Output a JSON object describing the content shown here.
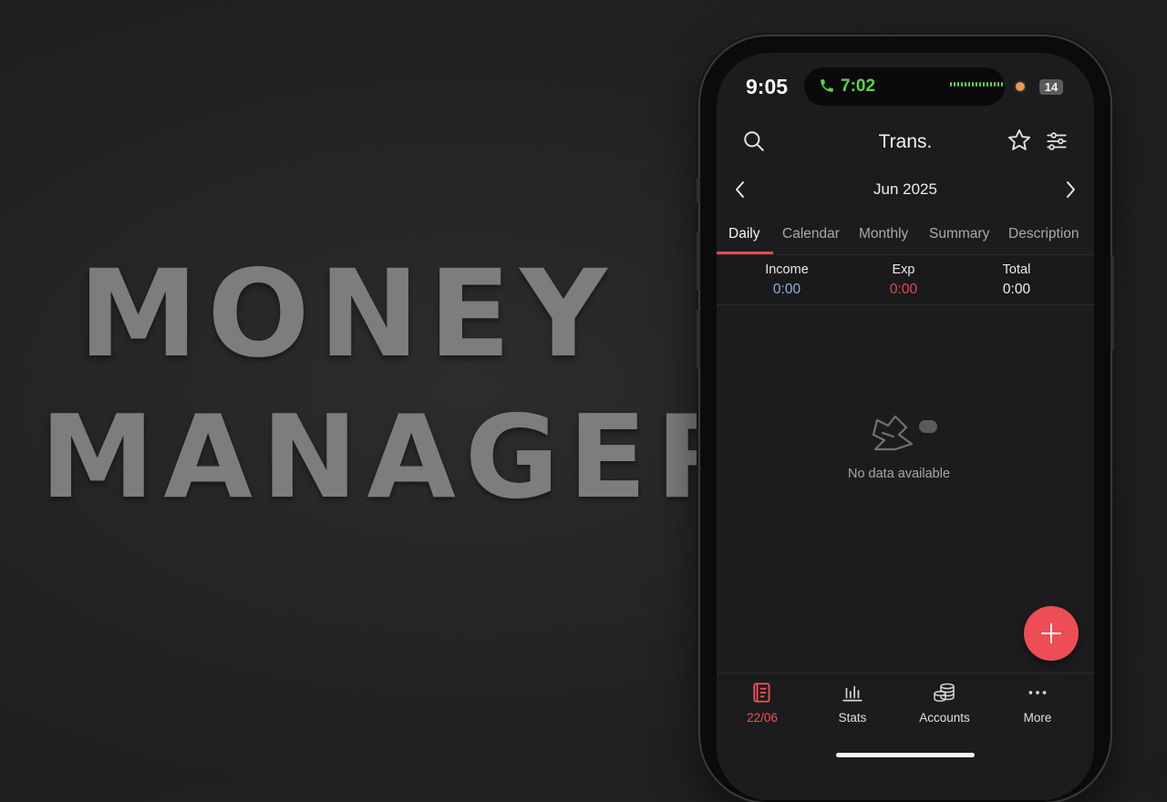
{
  "hero": {
    "line1": "MONEY",
    "line2": "MANAGER"
  },
  "status_bar": {
    "time": "9:05",
    "call_time": "7:02",
    "battery": "14"
  },
  "header": {
    "title": "Trans.",
    "month": "Jun 2025"
  },
  "tabs": [
    {
      "label": "Daily",
      "active": true
    },
    {
      "label": "Calendar",
      "active": false
    },
    {
      "label": "Monthly",
      "active": false
    },
    {
      "label": "Summary",
      "active": false
    },
    {
      "label": "Description",
      "active": false
    }
  ],
  "summary": {
    "income_label": "Income",
    "income_value": "0:00",
    "exp_label": "Exp",
    "exp_value": "0:00",
    "total_label": "Total",
    "total_value": "0:00"
  },
  "empty_state": {
    "text": "No data available"
  },
  "bottom_nav": [
    {
      "label": "22/06",
      "icon": "ledger-icon",
      "active": true
    },
    {
      "label": "Stats",
      "icon": "bar-chart-icon",
      "active": false
    },
    {
      "label": "Accounts",
      "icon": "coins-icon",
      "active": false
    },
    {
      "label": "More",
      "icon": "more-dots-icon",
      "active": false
    }
  ],
  "colors": {
    "accent": "#ed4d55",
    "income": "#8fb0d9",
    "expense": "#e8474f",
    "call_green": "#5ed348",
    "hero_text": "#7d7d7d"
  }
}
